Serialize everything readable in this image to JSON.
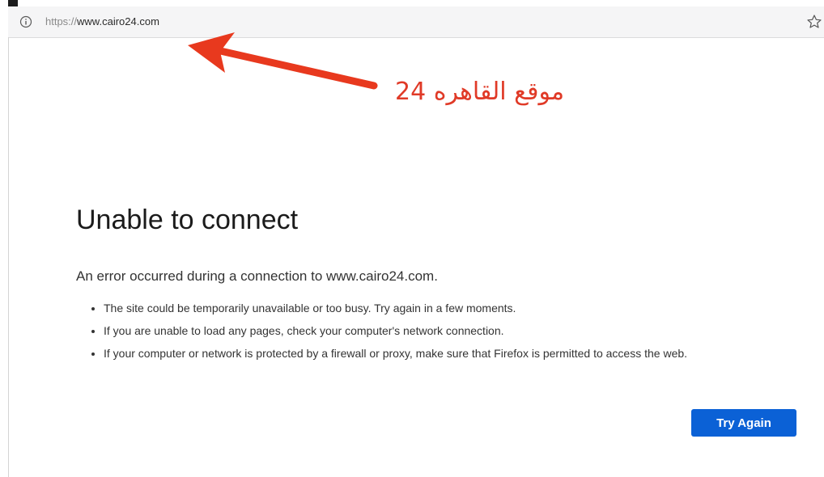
{
  "browser": {
    "url_scheme": "https://",
    "url_host": "www.cairo24.com",
    "info_icon": "info-icon",
    "bookmark_icon": "star-icon"
  },
  "annotation": {
    "text": "موقع القاهره 24",
    "color": "#e03a27"
  },
  "error_page": {
    "title": "Unable to connect",
    "message": "An error occurred during a connection to www.cairo24.com.",
    "reasons": [
      "The site could be temporarily unavailable or too busy. Try again in a few moments.",
      "If you are unable to load any pages, check your computer's network connection.",
      "If your computer or network is protected by a firewall or proxy, make sure that Firefox is permitted to access the web."
    ],
    "button_label": "Try Again",
    "button_color": "#0b61d6"
  }
}
